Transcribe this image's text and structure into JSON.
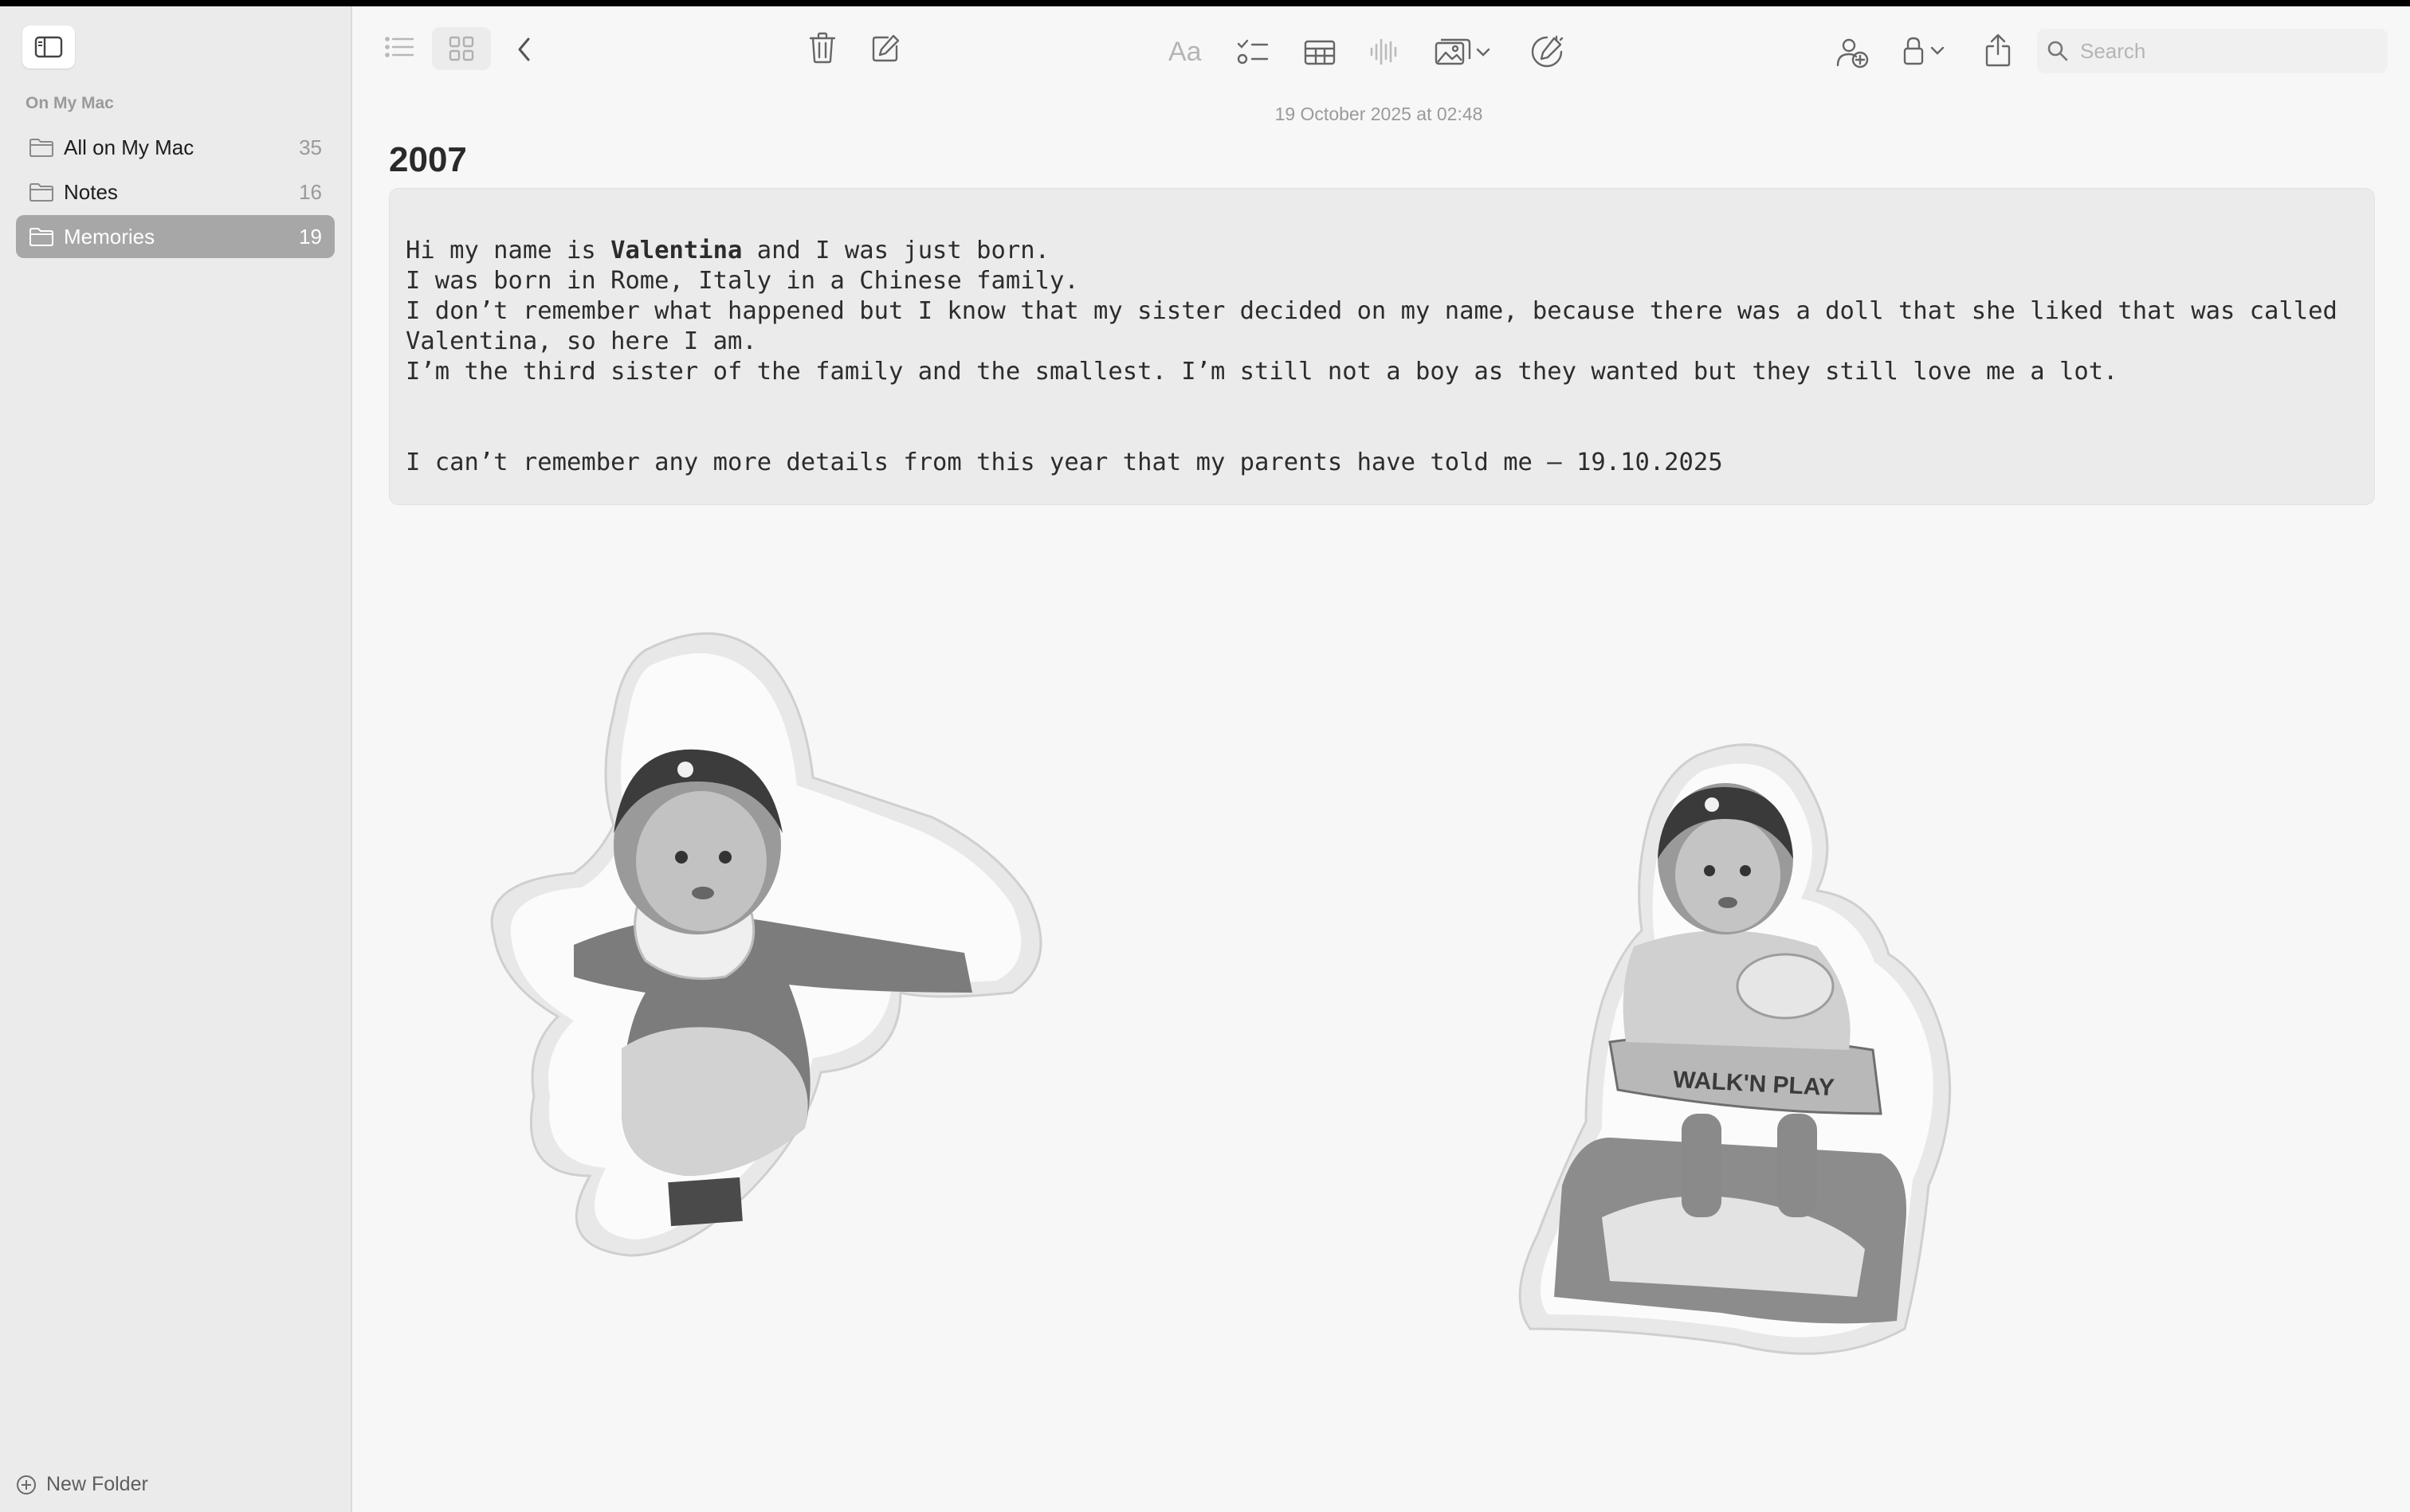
{
  "sidebar": {
    "section_title": "On My Mac",
    "folders": [
      {
        "name": "All on My Mac",
        "count": "35"
      },
      {
        "name": "Notes",
        "count": "16"
      },
      {
        "name": "Memories",
        "count": "19"
      }
    ],
    "new_folder_label": "New Folder"
  },
  "toolbar": {
    "search_placeholder": "Search",
    "format_label": "Aa"
  },
  "note": {
    "date": "19 October 2025 at 02:48",
    "title": "2007",
    "line1_pre": "Hi my name is ",
    "line1_bold": "Valentina",
    "line1_post": " and I was just born.",
    "line2": "I was born in Rome, Italy in a Chinese family.",
    "line3": "I don’t remember what happened but I know that my sister decided on my name, because there was a doll that she liked that was called",
    "line4": "Valentina, so here I am.",
    "line5": "I’m the third sister of the family and the smallest. I’m still not a boy as they wanted but they still love me a lot.",
    "line6": "I can’t remember any more details from this year that my parents have told me – 19.10.2025"
  },
  "stickers": {
    "walker_brand": "WALK'N PLAY"
  },
  "colors": {
    "selected_folder": "#a7a7a7",
    "sidebar_bg": "#ebebeb",
    "content_bg": "#f7f7f7"
  }
}
